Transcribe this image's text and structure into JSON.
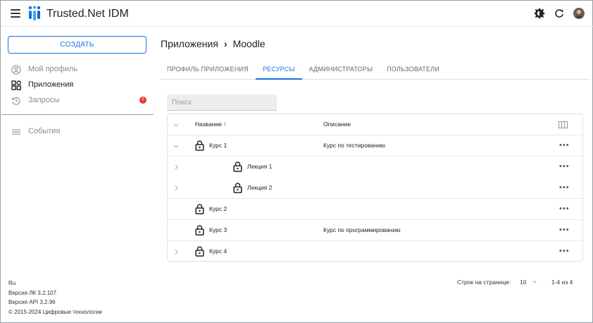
{
  "header": {
    "app_title": "Trusted.Net IDM",
    "icons": [
      "menu-icon",
      "logo-icon",
      "theme-toggle-icon",
      "refresh-icon",
      "avatar"
    ]
  },
  "sidebar": {
    "create_label": "СОЗДАТЬ",
    "items": [
      {
        "label": "Мой профиль",
        "icon": "user-circle-icon"
      },
      {
        "label": "Приложения",
        "icon": "apps-icon"
      },
      {
        "label": "Запросы",
        "icon": "history-icon",
        "badge": "!"
      },
      {
        "label": "События",
        "icon": "list-icon"
      }
    ],
    "footer": {
      "lang": "Ru",
      "version_lk": "Версия ЛК 3.2.107",
      "version_api": "Версия API 3.2.96",
      "copyright": "© 2015-2024 Цифровые технологии"
    }
  },
  "main": {
    "breadcrumb": {
      "parent": "Приложения",
      "separator": "›",
      "current": "Moodle"
    },
    "tabs": [
      {
        "label": "ПРОФИЛЬ ПРИЛОЖЕНИЯ",
        "active": false
      },
      {
        "label": "РЕСУРСЫ",
        "active": true
      },
      {
        "label": "АДМИНИСТРАТОРЫ",
        "active": false
      },
      {
        "label": "ПОЛЬЗОВАТЕЛИ",
        "active": false
      }
    ],
    "search_placeholder": "Поиск",
    "table": {
      "col_name": "Название ↑",
      "col_desc": "Описание",
      "rows": [
        {
          "name": "Курс 1",
          "desc": "Курс по тестированию",
          "level": 0,
          "expand": "down"
        },
        {
          "name": "Лекция 1",
          "desc": "",
          "level": 1,
          "expand": "right"
        },
        {
          "name": "Лекция 2",
          "desc": "",
          "level": 1,
          "expand": "right"
        },
        {
          "name": "Курс 2",
          "desc": "",
          "level": 0,
          "expand": "none"
        },
        {
          "name": "Курс 3",
          "desc": "Курс по программированию",
          "level": 0,
          "expand": "none"
        },
        {
          "name": "Курс 4",
          "desc": "",
          "level": 0,
          "expand": "right"
        }
      ],
      "more_label": "•••"
    },
    "pager": {
      "rows_label": "Строк на странице:",
      "rows_value": "10",
      "range": "1-4 из 4"
    }
  },
  "colors": {
    "accent": "#1a73e8",
    "badge": "#e53935"
  }
}
